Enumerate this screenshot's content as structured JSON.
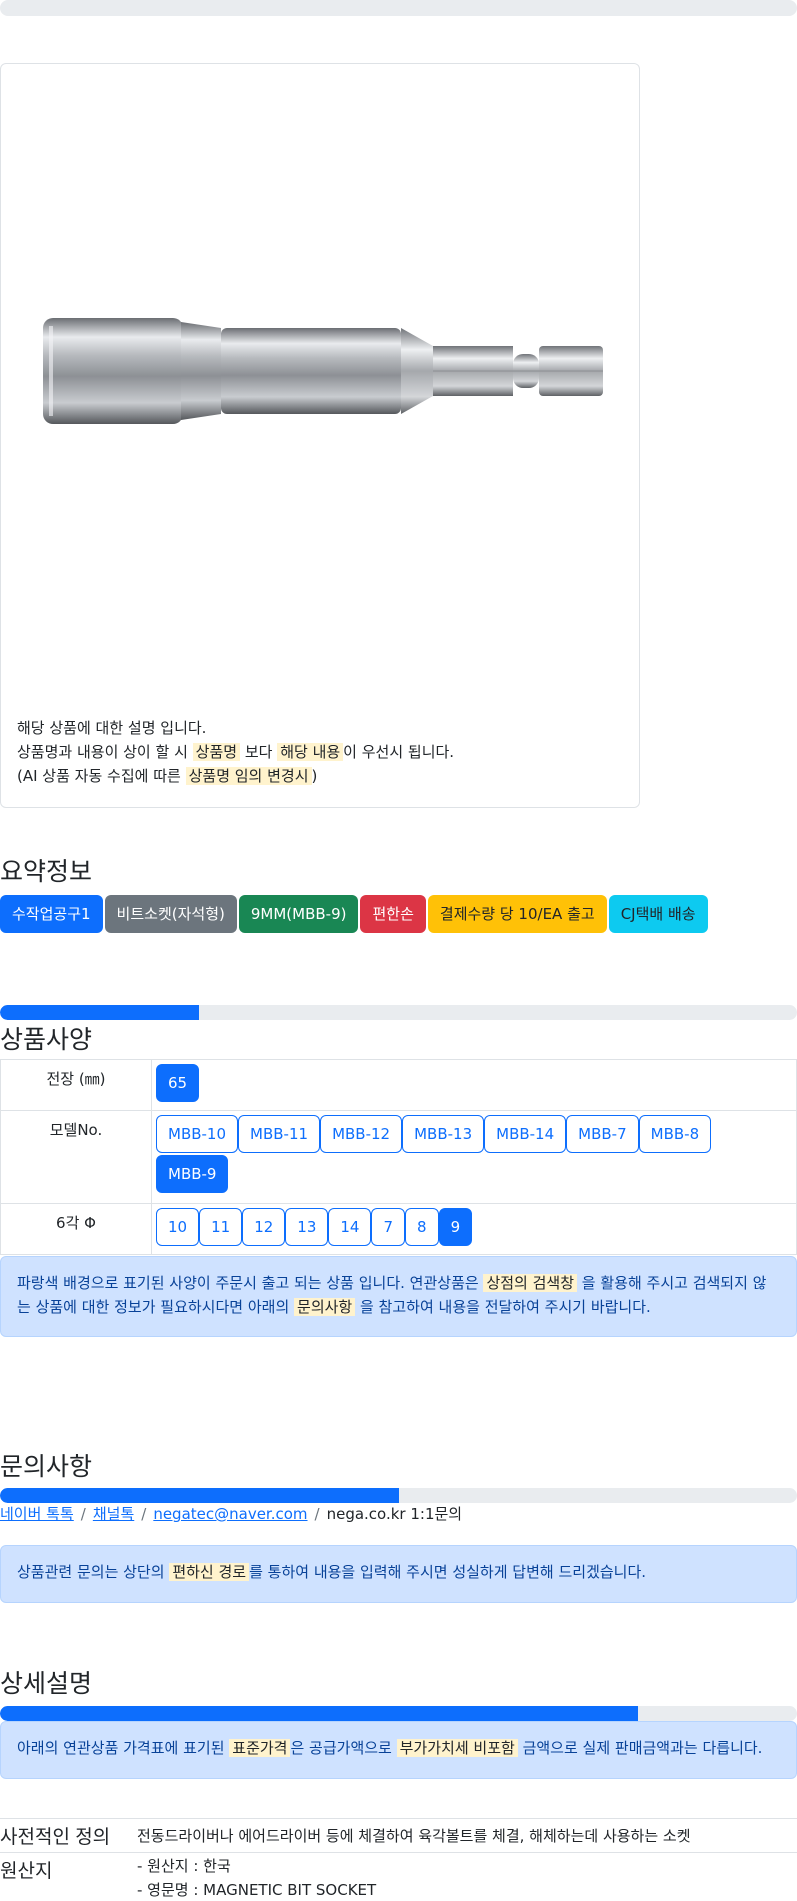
{
  "product": {
    "image_icon": "hex-bit-socket-photo",
    "desc_line1": "해당 상품에 대한 설명 입니다.",
    "desc_line2_a": "상품명과 내용이 상이 할 시 ",
    "desc_line2_hl1": "상품명",
    "desc_line2_b": " 보다 ",
    "desc_line2_hl2": "해당 내용",
    "desc_line2_c": "이 우선시 됩니다.",
    "desc_line3_a": "(AI 상품 자동 수집에 따른 ",
    "desc_line3_hl": "상품명 임의 변경시",
    "desc_line3_b": ")"
  },
  "summary": {
    "title": "요약정보",
    "badges": [
      "수작업공구1",
      "비트소켓(자석형)",
      "9MM(MBB-9)",
      "편한손",
      "결제수량 당 10/EA 출고",
      "CJ택배 배송"
    ]
  },
  "specs": {
    "title": "상품사양",
    "progress": 0.25,
    "rows": [
      {
        "key": "전장 (㎜)",
        "options": [
          "65"
        ],
        "active": "65"
      },
      {
        "key": "모델No.",
        "options": [
          "MBB-10",
          "MBB-11",
          "MBB-12",
          "MBB-13",
          "MBB-14",
          "MBB-7",
          "MBB-8",
          "MBB-9"
        ],
        "active": "MBB-9"
      },
      {
        "key": "6각 Φ",
        "options": [
          "10",
          "11",
          "12",
          "13",
          "14",
          "7",
          "8",
          "9"
        ],
        "active": "9"
      }
    ],
    "notice_a": "파랑색 배경으로 표기된 사양이 주문시 출고 되는 상품 입니다. 연관상품은 ",
    "notice_hl1": "상점의 검색창",
    "notice_b": " 을 활용해 주시고 검색되지 않는 상품에 대한 정보가 필요하시다면 아래의 ",
    "notice_hl2": "문의사항",
    "notice_c": " 을 참고하여 내용을 전달하여 주시기 바랍니다."
  },
  "inquiry": {
    "title": "문의사항",
    "progress": 0.5,
    "links": [
      "네이버 톡톡",
      "채널톡",
      "negatec@naver.com"
    ],
    "last": "nega.co.kr 1:1문의",
    "notice_a": "상품관련 문의는 상단의 ",
    "notice_hl": "편하신 경로",
    "notice_b": "를 통하여 내용을 입력해 주시면 성실하게 답변해 드리겠습니다."
  },
  "detail": {
    "title": "상세설명",
    "progress": 0.8,
    "notice_a": "아래의 연관상품 가격표에 표기된 ",
    "notice_hl1": "표준가격",
    "notice_b": "은 공급가액으로 ",
    "notice_hl2": "부가가치세 비포함",
    "notice_c": " 금액으로 실제 판매금액과는 다릅니다.",
    "definition_key": "사전적인 정의",
    "definition_val": "전동드라이버나 에어드라이버 등에 체결하여 육각볼트를 체결, 해체하는데 사용하는 소켓",
    "origin_key": "원산지",
    "origin_line1": "- 원산지 : 한국",
    "origin_line2": "- 영문명 : MAGNETIC BIT SOCKET"
  },
  "colors": {
    "primary": "#0d6efd",
    "highlight": "#fff3cd",
    "alert_bg": "#cfe2ff"
  }
}
